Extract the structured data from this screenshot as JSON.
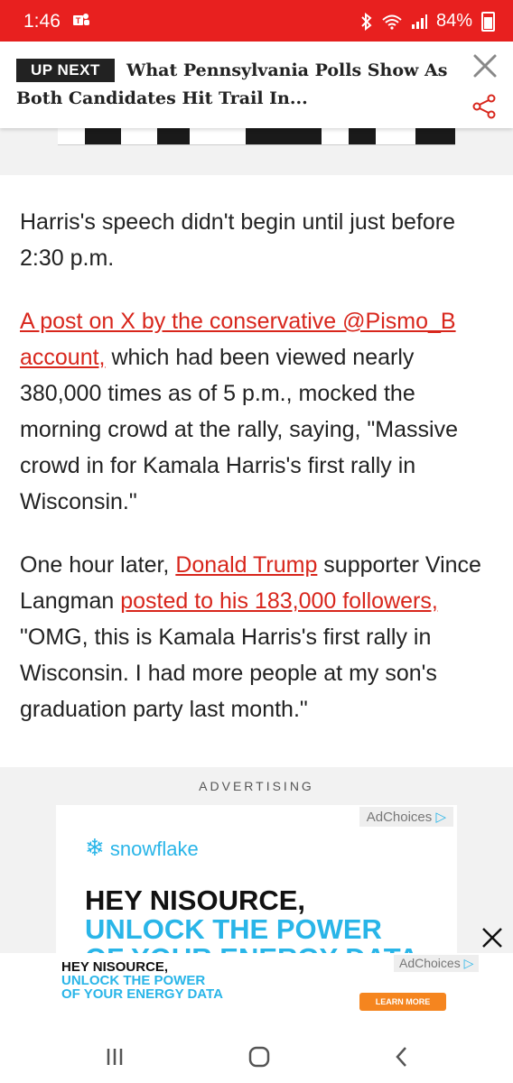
{
  "status_bar": {
    "time": "1:46",
    "battery": "84%"
  },
  "up_next": {
    "badge": "UP NEXT",
    "headline": "What Pennsylvania Polls Show As Both Candidates Hit Trail In..."
  },
  "article": {
    "p1": "Harris's speech didn't begin until just before 2:30 p.m.",
    "p2_link": "A post on X by the conservative @Pismo_B account,",
    "p2_rest": " which had been viewed nearly 380,000 times as of 5 p.m., mocked the morning crowd at the rally, saying, \"Massive crowd in for Kamala Harris's first rally in Wisconsin.\"",
    "p3_a": "One hour later, ",
    "p3_link1": "Donald Trump",
    "p3_b": " supporter Vince Langman ",
    "p3_link2": "posted to his 183,000 followers,",
    "p3_c": " \"OMG, this is Kamala Harris's first rally in Wisconsin. I had more people at my son's graduation party last month.\""
  },
  "ad": {
    "label": "ADVERTISING",
    "adchoices": "AdChoices",
    "brand": "snowflake",
    "line1": "HEY NISOURCE,",
    "line2": "UNLOCK THE POWER",
    "line3": "OF YOUR ENERGY DATA"
  },
  "bottom_ad": {
    "line1": "HEY NISOURCE,",
    "line2": "UNLOCK THE POWER",
    "line3": "OF YOUR ENERGY DATA",
    "adchoices": "AdChoices",
    "button": "LEARN MORE"
  },
  "colors": {
    "brand_red": "#e8201f",
    "link_red": "#d8261c",
    "snowflake_blue": "#29b5e8"
  }
}
